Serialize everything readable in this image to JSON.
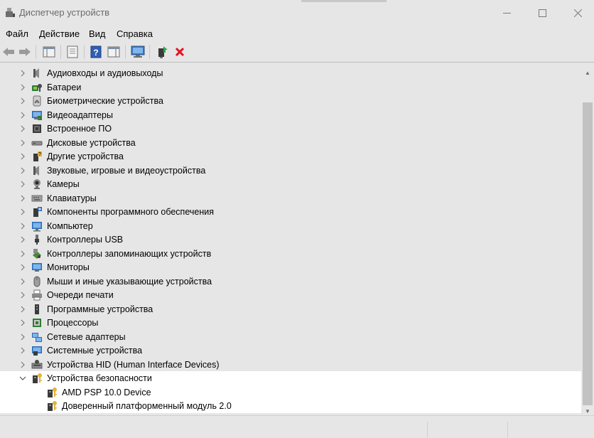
{
  "window": {
    "title": "Диспетчер устройств"
  },
  "menu": [
    "Файл",
    "Действие",
    "Вид",
    "Справка"
  ],
  "categories": [
    {
      "label": "Аудиовходы и аудиовыходы",
      "icon": "speaker-icon"
    },
    {
      "label": "Батареи",
      "icon": "battery-icon"
    },
    {
      "label": "Биометрические устройства",
      "icon": "fingerprint-icon"
    },
    {
      "label": "Видеоадаптеры",
      "icon": "display-adapter-icon"
    },
    {
      "label": "Встроенное ПО",
      "icon": "firmware-icon"
    },
    {
      "label": "Дисковые устройства",
      "icon": "disk-drive-icon"
    },
    {
      "label": "Другие устройства",
      "icon": "unknown-device-icon"
    },
    {
      "label": "Звуковые, игровые и видеоустройства",
      "icon": "speaker-icon"
    },
    {
      "label": "Камеры",
      "icon": "camera-icon"
    },
    {
      "label": "Клавиатуры",
      "icon": "keyboard-icon"
    },
    {
      "label": "Компоненты программного обеспечения",
      "icon": "software-component-icon"
    },
    {
      "label": "Компьютер",
      "icon": "computer-icon"
    },
    {
      "label": "Контроллеры USB",
      "icon": "usb-icon"
    },
    {
      "label": "Контроллеры запоминающих устройств",
      "icon": "storage-controller-icon"
    },
    {
      "label": "Мониторы",
      "icon": "monitor-icon"
    },
    {
      "label": "Мыши и иные указывающие устройства",
      "icon": "mouse-icon"
    },
    {
      "label": "Очереди печати",
      "icon": "printer-icon"
    },
    {
      "label": "Программные устройства",
      "icon": "software-device-icon"
    },
    {
      "label": "Процессоры",
      "icon": "processor-icon"
    },
    {
      "label": "Сетевые адаптеры",
      "icon": "network-adapter-icon"
    },
    {
      "label": "Системные устройства",
      "icon": "system-device-icon"
    },
    {
      "label": "Устройства HID (Human Interface Devices)",
      "icon": "hid-icon"
    }
  ],
  "expanded": {
    "label": "Устройства безопасности",
    "icon": "security-device-icon",
    "children": [
      {
        "label": "AMD PSP 10.0 Device",
        "icon": "security-device-icon"
      },
      {
        "label": "Доверенный платформенный модуль 2.0",
        "icon": "security-device-icon"
      }
    ]
  },
  "colors": {
    "background": "#e6e6e6",
    "selected_row": "#ffffff",
    "delete_red": "#e81123"
  }
}
